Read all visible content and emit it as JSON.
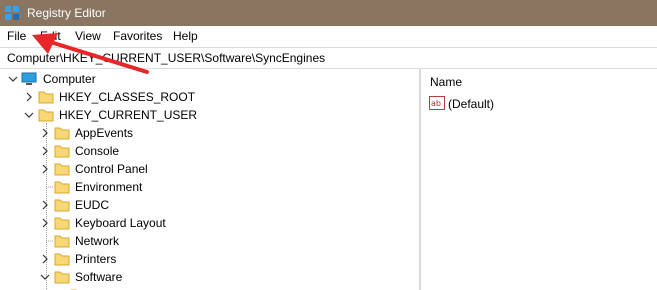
{
  "window": {
    "title": "Registry Editor"
  },
  "menu": [
    {
      "label": "File"
    },
    {
      "label": "Edit"
    },
    {
      "label": "View"
    },
    {
      "label": "Favorites"
    },
    {
      "label": "Help"
    }
  ],
  "address": {
    "path": "Computer\\HKEY_CURRENT_USER\\Software\\SyncEngines"
  },
  "tree": {
    "root": {
      "label": "Computer",
      "expanded": true
    },
    "hives": [
      {
        "label": "HKEY_CLASSES_ROOT",
        "expanded": false
      },
      {
        "label": "HKEY_CURRENT_USER",
        "expanded": true
      }
    ],
    "children": [
      {
        "label": "AppEvents",
        "state": "collapsed"
      },
      {
        "label": "Console",
        "state": "collapsed"
      },
      {
        "label": "Control Panel",
        "state": "collapsed"
      },
      {
        "label": "Environment",
        "state": "leaf"
      },
      {
        "label": "EUDC",
        "state": "collapsed"
      },
      {
        "label": "Keyboard Layout",
        "state": "collapsed"
      },
      {
        "label": "Network",
        "state": "leaf"
      },
      {
        "label": "Printers",
        "state": "collapsed"
      },
      {
        "label": "Software",
        "state": "expanded"
      }
    ]
  },
  "values_pane": {
    "column_header": "Name",
    "values": [
      {
        "name": "(Default)",
        "icon": "reg-string-icon"
      }
    ]
  },
  "colors": {
    "titlebar": "#8a7660",
    "folder": "#f8d775",
    "annotation_arrow": "#e8262a"
  }
}
